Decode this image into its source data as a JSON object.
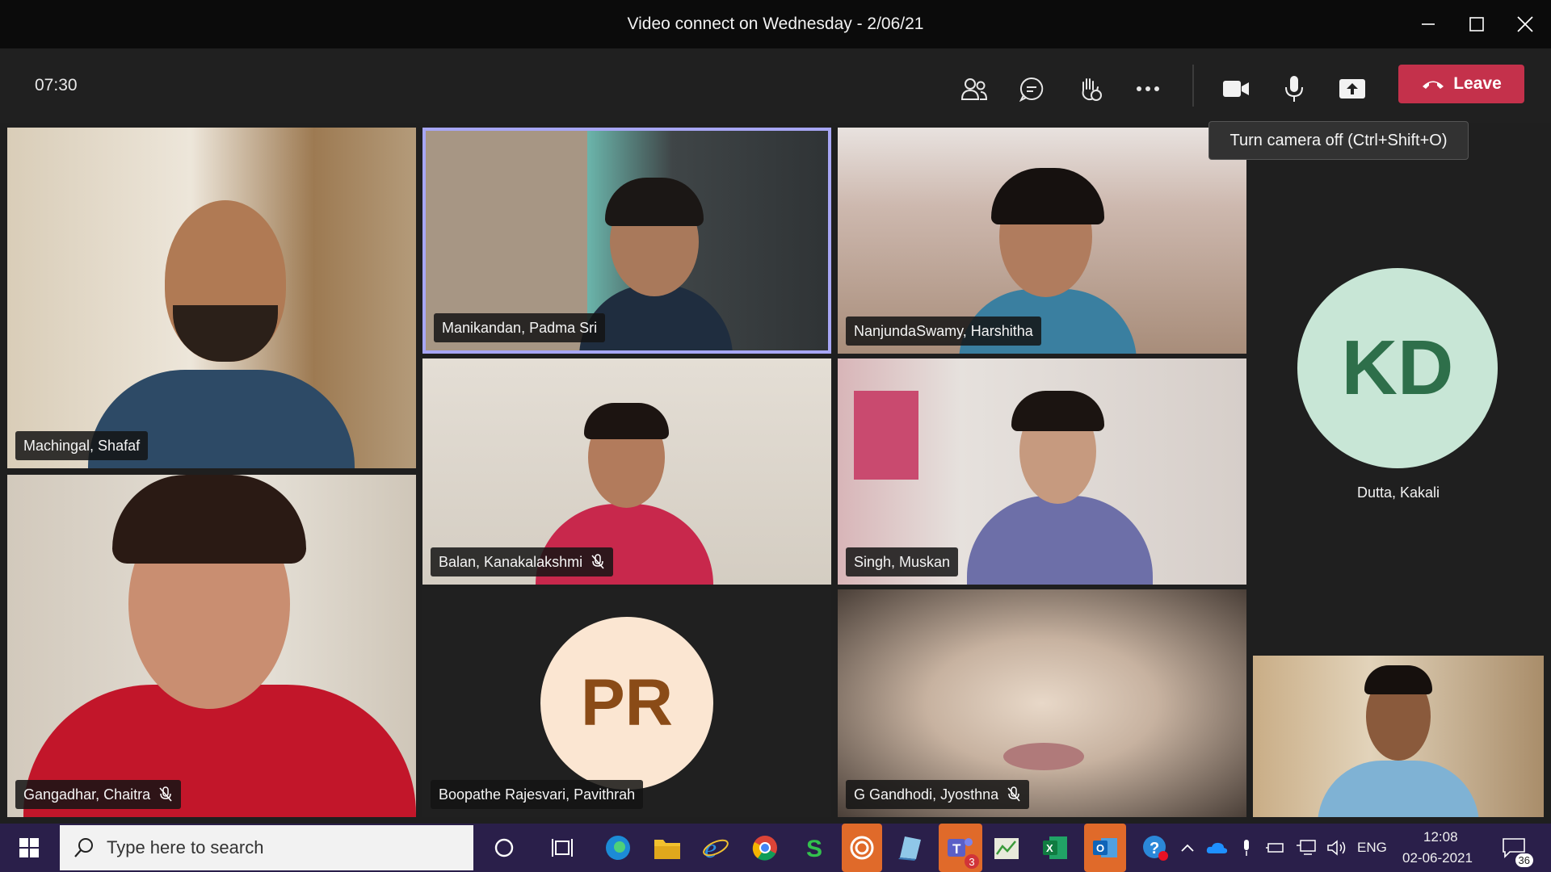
{
  "window": {
    "title": "Video connect on Wednesday - 2/06/21"
  },
  "toolbar": {
    "timer": "07:30",
    "leave_label": "Leave",
    "tooltip": "Turn camera off (Ctrl+Shift+O)"
  },
  "participants": [
    {
      "name": "Machingal, Shafaf",
      "muted": false
    },
    {
      "name": "Manikandan, Padma Sri",
      "muted": false,
      "active_speaker": true
    },
    {
      "name": "NanjundaSwamy, Harshitha",
      "muted": false
    },
    {
      "name": "Dutta, Kakali",
      "initials": "KD",
      "muted": false
    },
    {
      "name": "Gangadhar, Chaitra",
      "muted": true
    },
    {
      "name": "Balan, Kanakalakshmi",
      "muted": true
    },
    {
      "name": "Singh, Muskan",
      "muted": false
    },
    {
      "name": "Boopathe Rajesvari, Pavithrah",
      "initials": "PR",
      "muted": false
    },
    {
      "name": "G Gandhodi, Jyosthna",
      "muted": true
    }
  ],
  "taskbar": {
    "search_placeholder": "Type here to search",
    "language": "ENG",
    "time": "12:08",
    "date": "02-06-2021",
    "notification_count": "36",
    "teams_badge": "3"
  },
  "colors": {
    "leave": "#c4314b",
    "taskbar": "#2a1f4a",
    "active_border": "#a7a6f4"
  }
}
